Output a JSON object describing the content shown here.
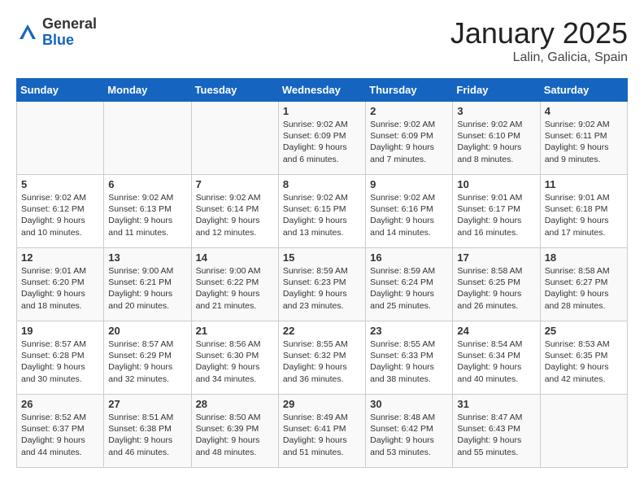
{
  "header": {
    "logo_general": "General",
    "logo_blue": "Blue",
    "month_title": "January 2025",
    "location": "Lalin, Galicia, Spain"
  },
  "weekdays": [
    "Sunday",
    "Monday",
    "Tuesday",
    "Wednesday",
    "Thursday",
    "Friday",
    "Saturday"
  ],
  "weeks": [
    [
      {
        "day": "",
        "info": ""
      },
      {
        "day": "",
        "info": ""
      },
      {
        "day": "",
        "info": ""
      },
      {
        "day": "1",
        "info": "Sunrise: 9:02 AM\nSunset: 6:09 PM\nDaylight: 9 hours and 6 minutes."
      },
      {
        "day": "2",
        "info": "Sunrise: 9:02 AM\nSunset: 6:09 PM\nDaylight: 9 hours and 7 minutes."
      },
      {
        "day": "3",
        "info": "Sunrise: 9:02 AM\nSunset: 6:10 PM\nDaylight: 9 hours and 8 minutes."
      },
      {
        "day": "4",
        "info": "Sunrise: 9:02 AM\nSunset: 6:11 PM\nDaylight: 9 hours and 9 minutes."
      }
    ],
    [
      {
        "day": "5",
        "info": "Sunrise: 9:02 AM\nSunset: 6:12 PM\nDaylight: 9 hours and 10 minutes."
      },
      {
        "day": "6",
        "info": "Sunrise: 9:02 AM\nSunset: 6:13 PM\nDaylight: 9 hours and 11 minutes."
      },
      {
        "day": "7",
        "info": "Sunrise: 9:02 AM\nSunset: 6:14 PM\nDaylight: 9 hours and 12 minutes."
      },
      {
        "day": "8",
        "info": "Sunrise: 9:02 AM\nSunset: 6:15 PM\nDaylight: 9 hours and 13 minutes."
      },
      {
        "day": "9",
        "info": "Sunrise: 9:02 AM\nSunset: 6:16 PM\nDaylight: 9 hours and 14 minutes."
      },
      {
        "day": "10",
        "info": "Sunrise: 9:01 AM\nSunset: 6:17 PM\nDaylight: 9 hours and 16 minutes."
      },
      {
        "day": "11",
        "info": "Sunrise: 9:01 AM\nSunset: 6:18 PM\nDaylight: 9 hours and 17 minutes."
      }
    ],
    [
      {
        "day": "12",
        "info": "Sunrise: 9:01 AM\nSunset: 6:20 PM\nDaylight: 9 hours and 18 minutes."
      },
      {
        "day": "13",
        "info": "Sunrise: 9:00 AM\nSunset: 6:21 PM\nDaylight: 9 hours and 20 minutes."
      },
      {
        "day": "14",
        "info": "Sunrise: 9:00 AM\nSunset: 6:22 PM\nDaylight: 9 hours and 21 minutes."
      },
      {
        "day": "15",
        "info": "Sunrise: 8:59 AM\nSunset: 6:23 PM\nDaylight: 9 hours and 23 minutes."
      },
      {
        "day": "16",
        "info": "Sunrise: 8:59 AM\nSunset: 6:24 PM\nDaylight: 9 hours and 25 minutes."
      },
      {
        "day": "17",
        "info": "Sunrise: 8:58 AM\nSunset: 6:25 PM\nDaylight: 9 hours and 26 minutes."
      },
      {
        "day": "18",
        "info": "Sunrise: 8:58 AM\nSunset: 6:27 PM\nDaylight: 9 hours and 28 minutes."
      }
    ],
    [
      {
        "day": "19",
        "info": "Sunrise: 8:57 AM\nSunset: 6:28 PM\nDaylight: 9 hours and 30 minutes."
      },
      {
        "day": "20",
        "info": "Sunrise: 8:57 AM\nSunset: 6:29 PM\nDaylight: 9 hours and 32 minutes."
      },
      {
        "day": "21",
        "info": "Sunrise: 8:56 AM\nSunset: 6:30 PM\nDaylight: 9 hours and 34 minutes."
      },
      {
        "day": "22",
        "info": "Sunrise: 8:55 AM\nSunset: 6:32 PM\nDaylight: 9 hours and 36 minutes."
      },
      {
        "day": "23",
        "info": "Sunrise: 8:55 AM\nSunset: 6:33 PM\nDaylight: 9 hours and 38 minutes."
      },
      {
        "day": "24",
        "info": "Sunrise: 8:54 AM\nSunset: 6:34 PM\nDaylight: 9 hours and 40 minutes."
      },
      {
        "day": "25",
        "info": "Sunrise: 8:53 AM\nSunset: 6:35 PM\nDaylight: 9 hours and 42 minutes."
      }
    ],
    [
      {
        "day": "26",
        "info": "Sunrise: 8:52 AM\nSunset: 6:37 PM\nDaylight: 9 hours and 44 minutes."
      },
      {
        "day": "27",
        "info": "Sunrise: 8:51 AM\nSunset: 6:38 PM\nDaylight: 9 hours and 46 minutes."
      },
      {
        "day": "28",
        "info": "Sunrise: 8:50 AM\nSunset: 6:39 PM\nDaylight: 9 hours and 48 minutes."
      },
      {
        "day": "29",
        "info": "Sunrise: 8:49 AM\nSunset: 6:41 PM\nDaylight: 9 hours and 51 minutes."
      },
      {
        "day": "30",
        "info": "Sunrise: 8:48 AM\nSunset: 6:42 PM\nDaylight: 9 hours and 53 minutes."
      },
      {
        "day": "31",
        "info": "Sunrise: 8:47 AM\nSunset: 6:43 PM\nDaylight: 9 hours and 55 minutes."
      },
      {
        "day": "",
        "info": ""
      }
    ]
  ]
}
